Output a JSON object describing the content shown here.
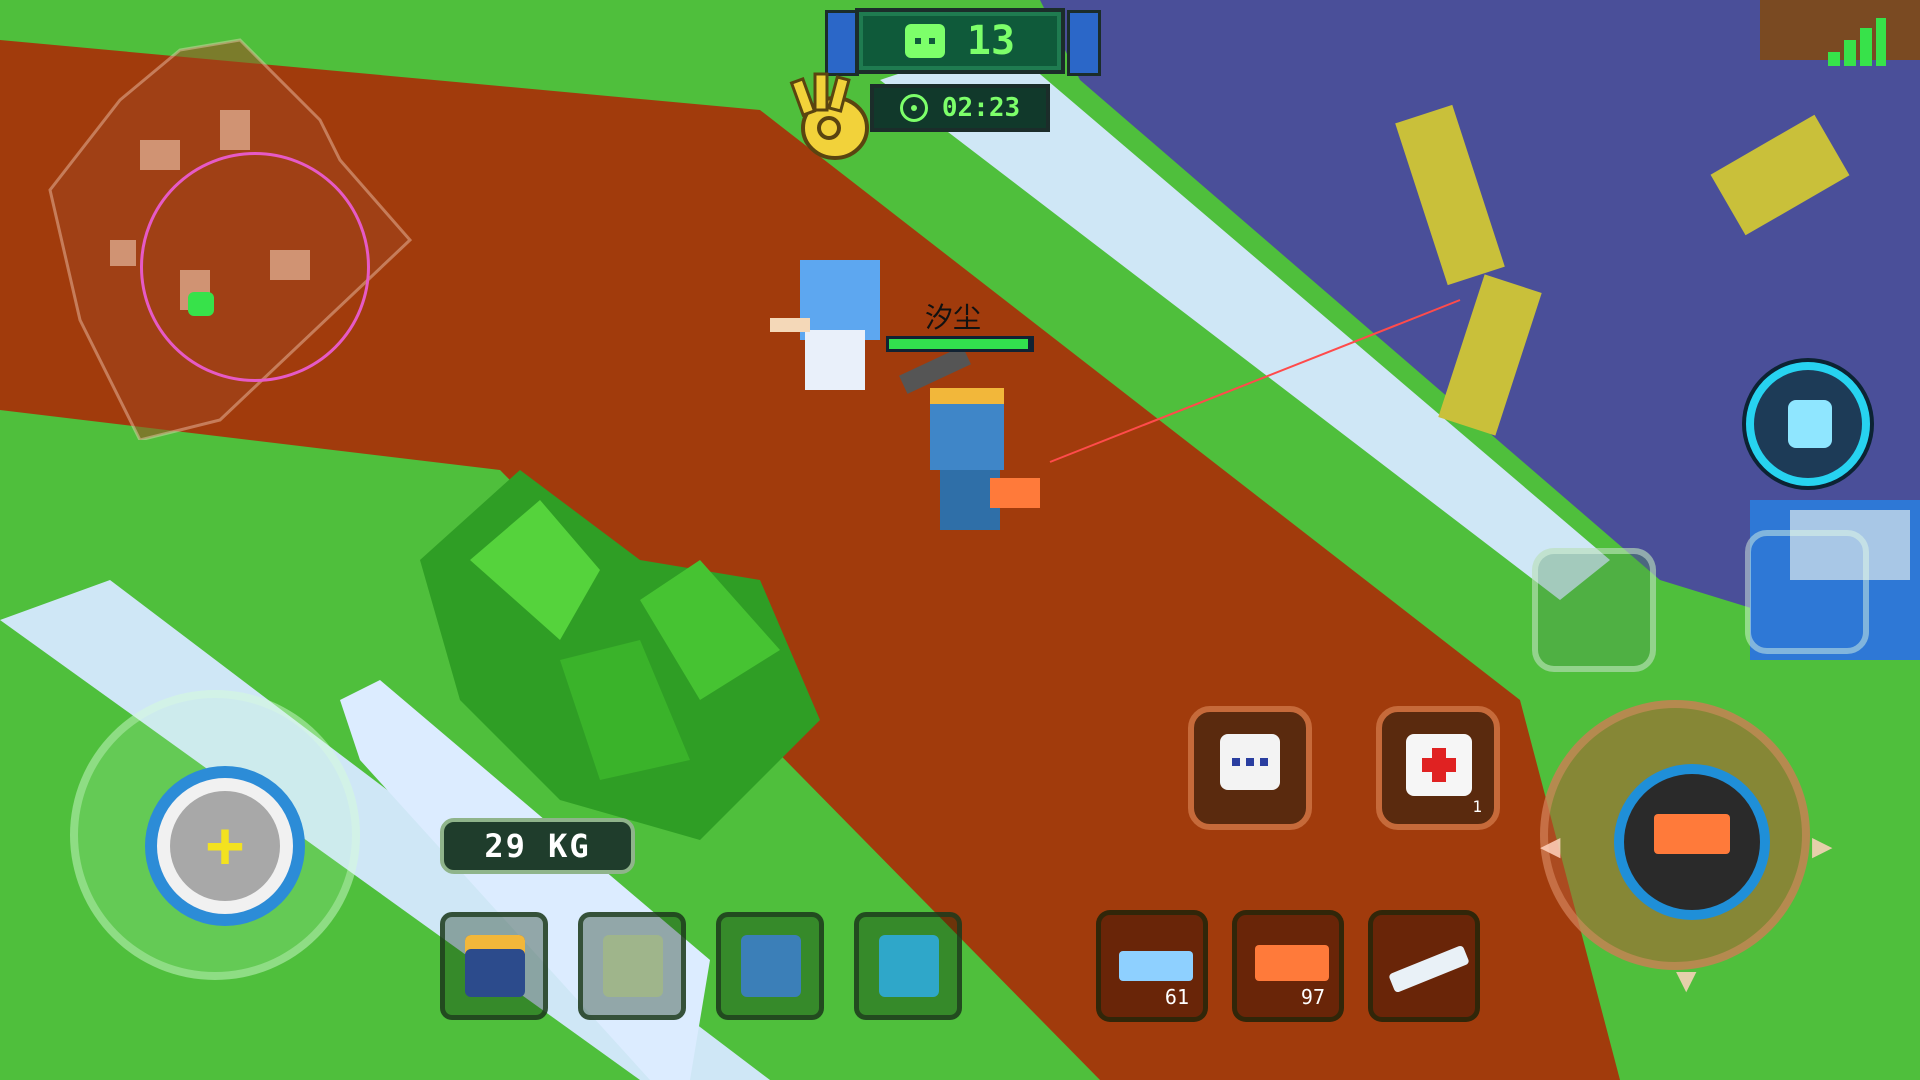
{
  "hud": {
    "players_alive": "13",
    "zone_timer": "02:23",
    "signal_icon": "signal-bars-icon",
    "emote_icon": "ok-hand-icon"
  },
  "player": {
    "name": "汐尘",
    "health": 0.98
  },
  "inventory": {
    "weight": "29 KG",
    "gear": [
      {
        "name": "helmet",
        "icon": "helmet-icon",
        "color": "#f2b73a"
      },
      {
        "name": "backpack",
        "icon": "backpack-icon",
        "color": "#9fb58b"
      },
      {
        "name": "pants",
        "icon": "pants-icon",
        "color": "#3b7fb8"
      },
      {
        "name": "shoes",
        "icon": "shoes-icon",
        "color": "#2fa7c9"
      }
    ]
  },
  "actions": {
    "chat_icon": "chat-bubble-icon",
    "medkit_icon": "medkit-icon",
    "medkit_count": "1"
  },
  "weapons": [
    {
      "name": "pistol",
      "icon": "pistol-icon",
      "ammo": "61"
    },
    {
      "name": "uzi",
      "icon": "uzi-icon",
      "ammo": "97"
    },
    {
      "name": "knife",
      "icon": "knife-icon",
      "ammo": ""
    }
  ],
  "fire": {
    "weapon_icon": "uzi-icon"
  },
  "colors": {
    "grass": "#4fbf3c",
    "zone_red": "#a13b0c",
    "road": "#4a4f99",
    "accent_green": "#7dff6a",
    "accent_blue": "#1f8fd8"
  }
}
